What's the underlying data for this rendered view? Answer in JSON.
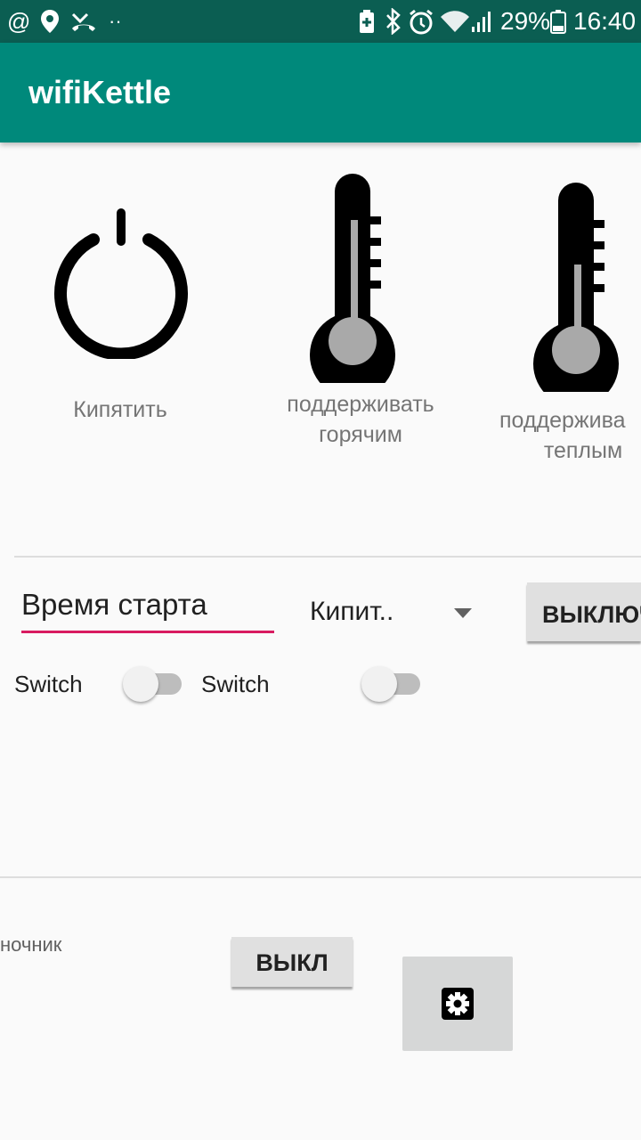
{
  "status_bar": {
    "icons": [
      "at-sign-icon",
      "location-pin-icon",
      "missed-call-icon",
      "more-dots-icon",
      "battery-saver-icon",
      "bluetooth-icon",
      "alarm-icon",
      "wifi-icon",
      "signal-icon",
      "battery-icon"
    ],
    "battery": "29%",
    "time": "16:40",
    "color": "#0b5e52"
  },
  "app_bar": {
    "title": "wifiKettle",
    "color": "#00897b"
  },
  "modes": [
    {
      "label": "Кипятить",
      "icon": "power-icon"
    },
    {
      "label_line1": "поддерживать",
      "label_line2": "горячим",
      "icon": "thermometer-hot-icon",
      "level": 0.85
    },
    {
      "label_line1": "поддержива",
      "label_line2": "теплым",
      "icon": "thermometer-warm-icon",
      "level": 0.5
    }
  ],
  "timer": {
    "start_time_placeholder": "Время старта",
    "mode_selected": "Кипит..",
    "off_button": "ВЫКЛЮЧ",
    "accent": "#d81b60"
  },
  "switches": [
    {
      "label": "Switch",
      "checked": false
    },
    {
      "label": "Switch",
      "checked": false
    }
  ],
  "nightlight": {
    "label": "ночник",
    "off_button": "ВЫКЛ",
    "settings_icon": "gear-icon"
  }
}
